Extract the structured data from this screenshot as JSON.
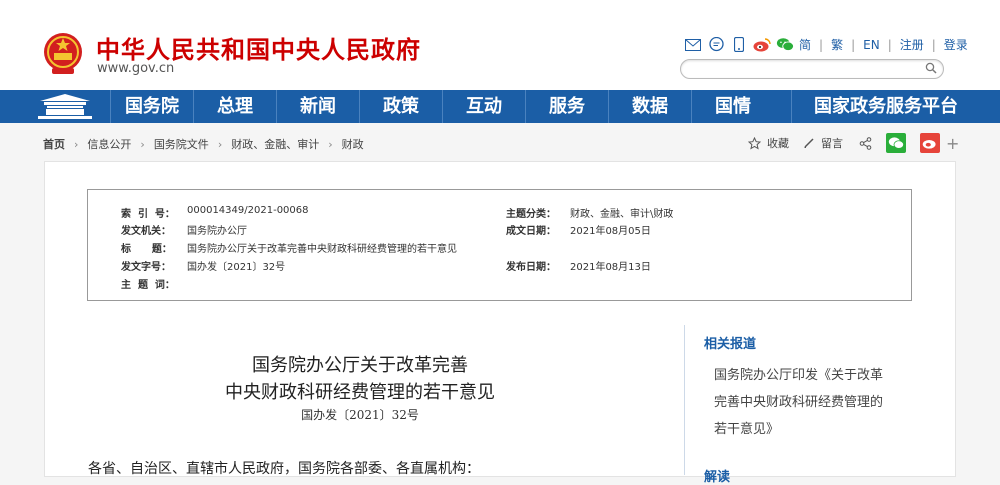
{
  "header": {
    "site_name": "中华人民共和国中央人民政府",
    "site_url": "www.gov.cn",
    "tools": [
      "简",
      "繁",
      "EN",
      "注册",
      "登录"
    ],
    "tool_icons": [
      "mail-icon",
      "chat-bubble-icon",
      "mobile-icon",
      "weibo-icon",
      "wechat-icon"
    ]
  },
  "nav": {
    "items": [
      "国务院",
      "总理",
      "新闻",
      "政策",
      "互动",
      "服务",
      "数据",
      "国情",
      "国家政务服务平台"
    ]
  },
  "breadcrumb": {
    "items": [
      "首页",
      "信息公开",
      "国务院文件",
      "财政、金融、审计",
      "财政"
    ]
  },
  "share": {
    "favorite": "收藏",
    "comment": "留言",
    "more": "+"
  },
  "meta": {
    "index_label": "索  引  号：",
    "index_value": "000014349/2021-00068",
    "issuer_label": "发文机关：",
    "issuer_value": "国务院办公厅",
    "title_label": "标      题：",
    "title_value": "国务院办公厅关于改革完善中央财政科研经费管理的若干意见",
    "docno_label": "发文字号：",
    "docno_value": "国办发〔2021〕32号",
    "keywords_label": "主  题  词：",
    "keywords_value": "",
    "category_label": "主题分类：",
    "category_value": "财政、金融、审计\\财政",
    "created_label": "成文日期：",
    "created_value": "2021年08月05日",
    "published_label": "发布日期：",
    "published_value": "2021年08月13日"
  },
  "document": {
    "title_line1": "国务院办公厅关于改革完善",
    "title_line2": "中央财政科研经费管理的若干意见",
    "doc_number": "国办发〔2021〕32号",
    "salutation": "各省、自治区、直辖市人民政府，国务院各部委、各直属机构："
  },
  "sidebar": {
    "related_title": "相关报道",
    "related_link_line1": "国务院办公厅印发《关于改革",
    "related_link_line2": "完善中央财政科研经费管理的",
    "related_link_line3": "若干意见》",
    "interpret_title": "解读"
  },
  "colors": {
    "brand_red": "#cc0000",
    "nav_blue": "#1b5ea6",
    "wechat_green": "#2aae3a",
    "weibo_red": "#e6443a"
  }
}
